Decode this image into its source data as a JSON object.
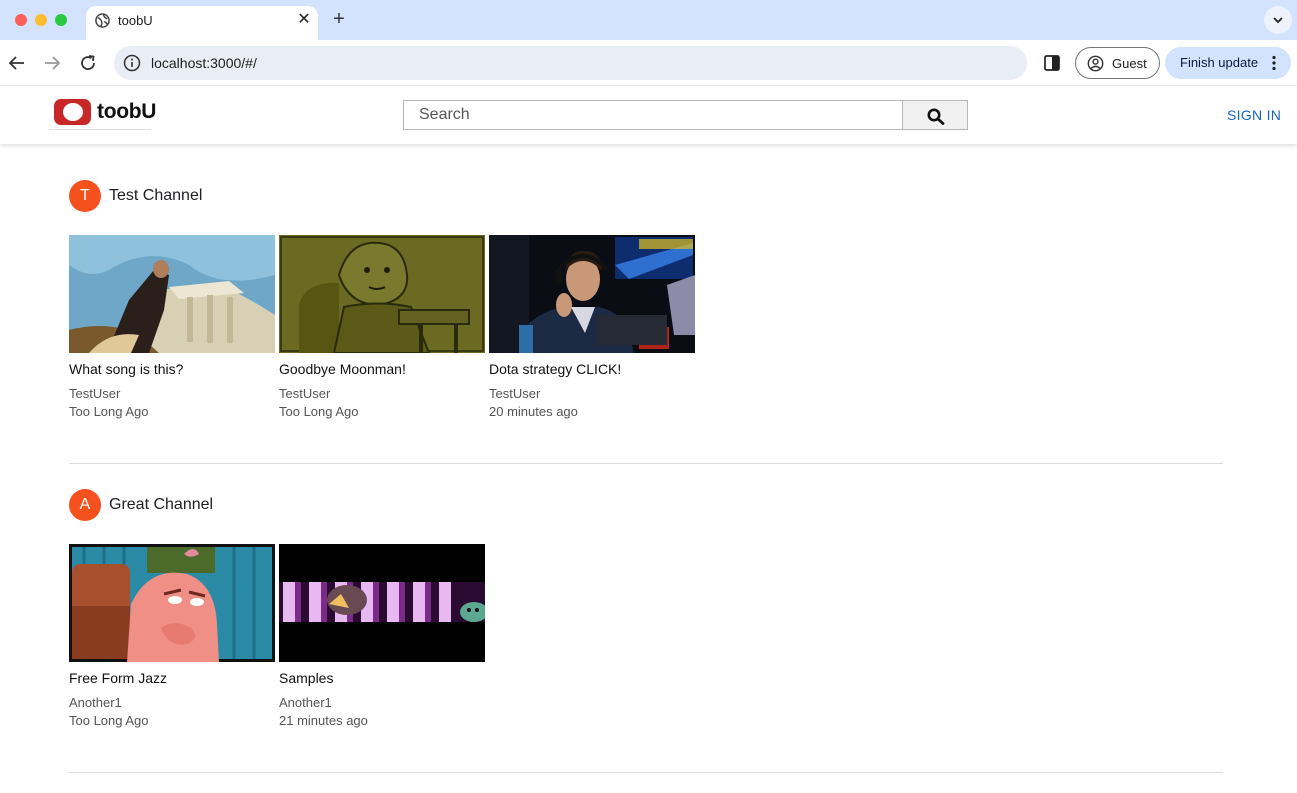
{
  "browser": {
    "tab_title": "toobU",
    "tab_close": "✕",
    "new_tab": "+",
    "url": "localhost:3000/#/",
    "profile_label": "Guest",
    "update_label": "Finish update"
  },
  "app": {
    "logo_text": "toobU",
    "search_placeholder": "Search",
    "signin_label": "SIGN IN"
  },
  "channels": [
    {
      "avatar_letter": "T",
      "name": "Test Channel",
      "videos": [
        {
          "title": "What song is this?",
          "user": "TestUser",
          "time": "Too Long Ago"
        },
        {
          "title": "Goodbye Moonman!",
          "user": "TestUser",
          "time": "Too Long Ago"
        },
        {
          "title": "Dota strategy CLICK!",
          "user": "TestUser",
          "time": "20 minutes ago"
        }
      ]
    },
    {
      "avatar_letter": "A",
      "name": "Great Channel",
      "videos": [
        {
          "title": "Free Form Jazz",
          "user": "Another1",
          "time": "Too Long Ago"
        },
        {
          "title": "Samples",
          "user": "Another1",
          "time": "21 minutes ago"
        }
      ]
    }
  ],
  "colors": {
    "brand_red": "#c62828",
    "avatar_orange": "#f4511e",
    "signin_blue": "#1565c0",
    "tabbar_blue": "#d3e3fd"
  }
}
